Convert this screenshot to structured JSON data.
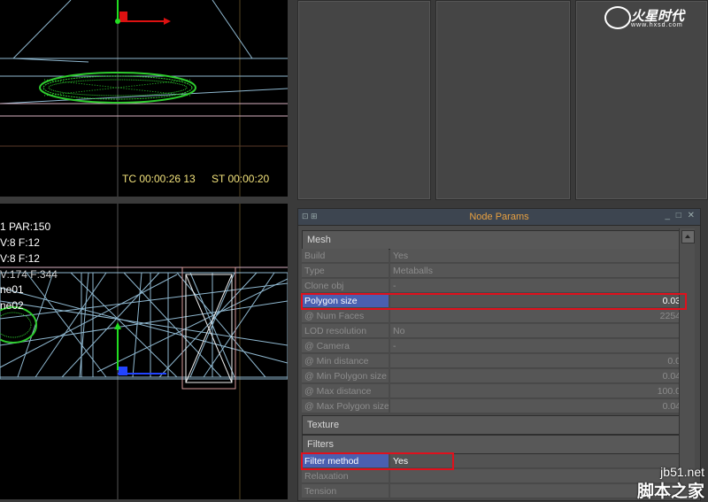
{
  "viewport_top": {
    "timecode": "TC 00:00:26 13",
    "stamp": "ST 00:00:20"
  },
  "viewport_bottom": {
    "hud_lines": [
      "1 PAR:150",
      "V:8 F:12",
      "V:8 F:12",
      "V:174 F:344",
      "ne01",
      "ne02"
    ]
  },
  "logo": {
    "name": "火星时代",
    "url": "www.hxsd.com"
  },
  "panel": {
    "title": "Node Params",
    "left_icons": "⊡ ⊞",
    "right_icons": "_ □ ✕",
    "sections": {
      "mesh": "Mesh",
      "texture": "Texture",
      "filters": "Filters"
    },
    "mesh_rows": [
      {
        "label": "Build",
        "value": "Yes"
      },
      {
        "label": "Type",
        "value": "Metaballs"
      },
      {
        "label": "Clone obj",
        "value": "-"
      },
      {
        "label": "Polygon size",
        "value": "0.03"
      },
      {
        "label": "@ Num Faces",
        "value": "2254"
      },
      {
        "label": "LOD resolution",
        "value": "No"
      },
      {
        "label": "@ Camera",
        "value": "-"
      },
      {
        "label": "@ Min distance",
        "value": "0.0"
      },
      {
        "label": "@ Min Polygon size",
        "value": "0.04"
      },
      {
        "label": "@ Max distance",
        "value": "100.0"
      },
      {
        "label": "@ Max Polygon size",
        "value": "0.04"
      }
    ],
    "filter_rows": [
      {
        "label": "Filter method",
        "value": "Yes"
      },
      {
        "label": "Relaxation",
        "value": ""
      },
      {
        "label": "Tension",
        "value": ""
      }
    ]
  },
  "watermark": {
    "site": "jb51.net",
    "name": "脚本之家"
  },
  "colors": {
    "highlight": "#4a5fb0",
    "title_text": "#e8a040",
    "annotation_box": "#e0101c",
    "mesh_green": "#2ecc2e"
  }
}
